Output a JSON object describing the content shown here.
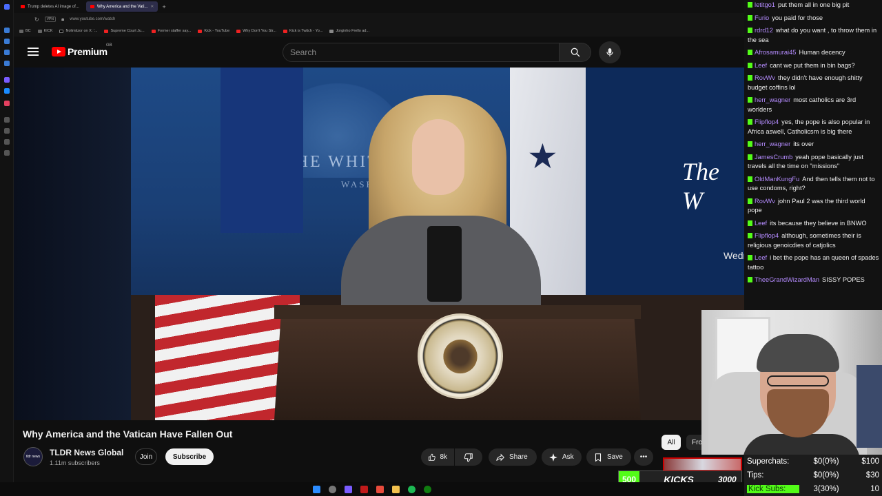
{
  "browser": {
    "tabs": [
      {
        "label": "Trump deletes AI image of...",
        "active": false
      },
      {
        "label": "Why America and the Vati...",
        "active": true
      }
    ],
    "new_tab": "+",
    "vpn_badge": "VPN",
    "url": "www.youtube.com/watch",
    "bookmarks": [
      "BC",
      "KICK",
      "Nolimitzor on X: '...",
      "Supreme Court Ju...",
      "Former staffer say...",
      "Kick - YouTube",
      "Why Don't You Str...",
      "Kick is Twitch - Yo...",
      "Jorginho Frello ad..."
    ]
  },
  "youtube": {
    "logo_text": "Premium",
    "region": "GB",
    "search_placeholder": "Search",
    "video_overlay_title": "The W",
    "video_overlay_day": "Wedne",
    "video_backdrop_text": "THE WHITE HOUSE",
    "video_backdrop_sub": "WASHINGTON",
    "video_title": "Why America and the Vatican Have Fallen Out",
    "channel": {
      "name": "TLDR News Global",
      "subscribers": "1.11m subscribers",
      "avatar_text": "tldr news"
    },
    "join_label": "Join",
    "subscribe_label": "Subscribe",
    "likes": "8k",
    "share_label": "Share",
    "ask_label": "Ask",
    "save_label": "Save",
    "more_label": "•••",
    "filters": {
      "all": "All",
      "from": "Fro"
    }
  },
  "chat": [
    {
      "user": "letitgo1",
      "text": "put them all in one big pit"
    },
    {
      "user": "Furio",
      "text": "you paid for those"
    },
    {
      "user": "rdrd12",
      "text": "what do you want , to throw them in the sea"
    },
    {
      "user": "Afrosamurai45",
      "text": "Human decency"
    },
    {
      "user": "Leef",
      "text": "cant we put them in bin bags?"
    },
    {
      "user": "RovWv",
      "text": "they didn't have enough shitty budget coffins lol"
    },
    {
      "user": "herr_wagner",
      "text": "most catholics are 3rd worlders"
    },
    {
      "user": "Flipflop4",
      "text": "yes, the pope is also popular in Africa aswell, Catholicsm is big there"
    },
    {
      "user": "herr_wagner",
      "text": "its over"
    },
    {
      "user": "JamesCrumb",
      "text": "yeah pope basically just travels all the time on \"missions\""
    },
    {
      "user": "OldManKungFu",
      "text": "And then tells them not to use condoms, right?"
    },
    {
      "user": "RovWv",
      "text": "john Paul 2 was the third world pope"
    },
    {
      "user": "Leef",
      "text": "its because they believe in BNWO"
    },
    {
      "user": "Flipflop4",
      "text": "although, sometimes their is religious genoicdies of catjolics"
    },
    {
      "user": "Leef",
      "text": "i bet the pope has an queen of spades tattoo"
    },
    {
      "user": "TheeGrandWizardMan",
      "text": "SISSY POPES"
    }
  ],
  "goals": [
    {
      "label": "Superchats:",
      "value": "$0(0%)",
      "target": "$100"
    },
    {
      "label": "Tips:",
      "value": "$0(0%)",
      "target": "$30"
    },
    {
      "label": "Kick Subs:",
      "value": "3(30%)",
      "target": "10"
    }
  ],
  "kicks": {
    "current": "500",
    "label": "KICKS",
    "target": "3000"
  },
  "colors": {
    "kick_green": "#53fc18",
    "yt_red": "#ff0000",
    "chat_user": "#b58cff"
  }
}
